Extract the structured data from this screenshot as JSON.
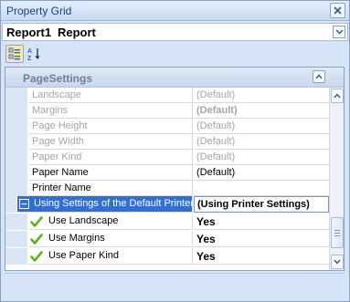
{
  "window": {
    "title": "Property Grid"
  },
  "selector": {
    "object_name": "Report1",
    "object_type": "Report"
  },
  "category": {
    "label": "PageSettings"
  },
  "rows": [
    {
      "name": "Landscape",
      "value": "(Default)"
    },
    {
      "name": "Margins",
      "value": "(Default)"
    },
    {
      "name": "Page Height",
      "value": "(Default)"
    },
    {
      "name": "Page Width",
      "value": "(Default)"
    },
    {
      "name": "Paper Kind",
      "value": "(Default)"
    },
    {
      "name": "Paper Name",
      "value": "(Default)"
    },
    {
      "name": "Printer Name",
      "value": ""
    },
    {
      "name": "Using Settings of the Default Printer",
      "value": "(Using Printer Settings)"
    },
    {
      "name": "Use Landscape",
      "value": "Yes"
    },
    {
      "name": "Use Margins",
      "value": "Yes"
    },
    {
      "name": "Use Paper Kind",
      "value": "Yes"
    }
  ],
  "colors": {
    "selection": "#2f6fd6",
    "check": "#5fb41c"
  },
  "icons": {
    "close": "close-icon",
    "dropdown": "chevron-down-icon",
    "categorized": "categorized-icon",
    "alphabetical": "sort-alphabetical-icon",
    "collapse": "chevron-up-icon",
    "expander": "minus-icon",
    "check": "check-icon"
  }
}
